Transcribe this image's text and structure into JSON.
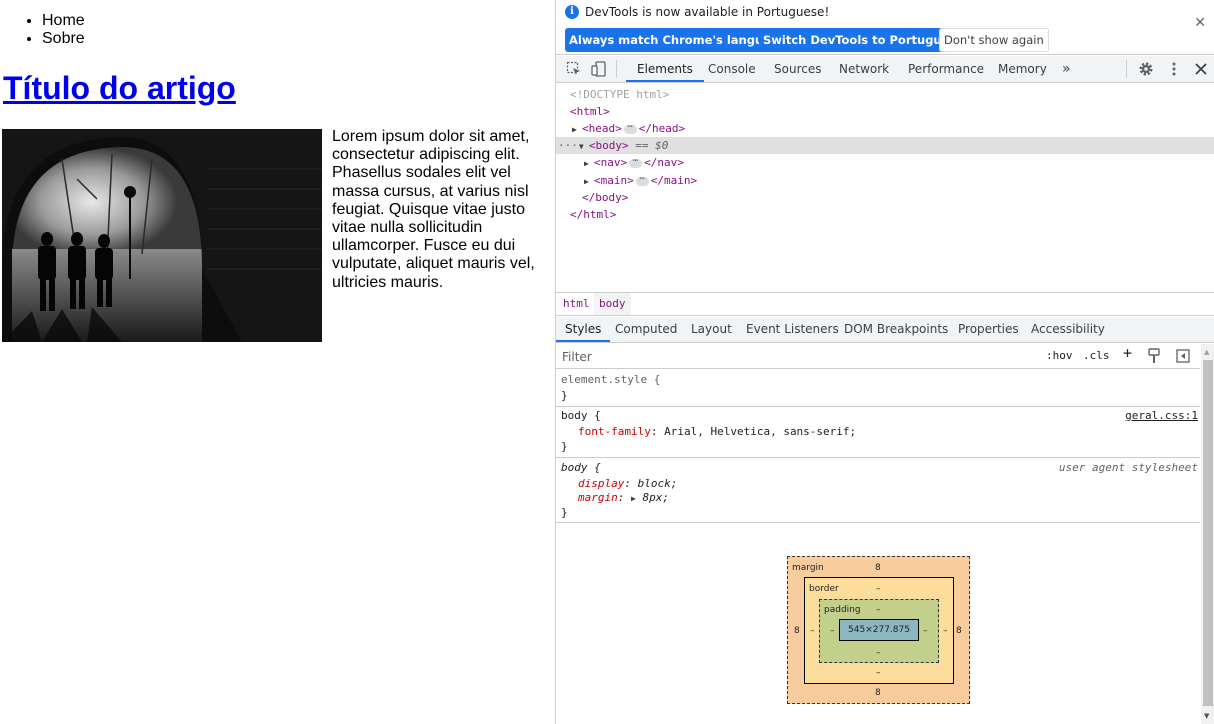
{
  "page": {
    "nav": [
      "Home",
      "Sobre"
    ],
    "article_title": "Título do artigo",
    "article_text": "Lorem ipsum dolor sit amet, consectetur adipiscing elit. Phasellus sodales elit vel massa cursus, at varius nisl feugiat. Quisque vitae justo vitae nulla sollicitudin ullamcorper. Fusce eu dui vulputate, aliquet mauris vel, ultricies mauris."
  },
  "infobar": {
    "message": "DevTools is now available in Portuguese!",
    "btn_match": "Always match Chrome's language",
    "btn_switch": "Switch DevTools to Portuguese",
    "btn_dismiss": "Don't show again"
  },
  "toolbar": {
    "tabs": [
      "Elements",
      "Console",
      "Sources",
      "Network",
      "Performance",
      "Memory"
    ],
    "more": "»"
  },
  "dom": {
    "doctype": "<!DOCTYPE html>",
    "html_open": "<html>",
    "head": "<head>",
    "head_close": "</head>",
    "body": "<body>",
    "body_marker": "== $0",
    "nav": "<nav>",
    "nav_close": "</nav>",
    "main": "<main>",
    "main_close": "</main>",
    "body_close": "</body>",
    "html_close": "</html>",
    "dots": "···"
  },
  "breadcrumbs": [
    "html",
    "body"
  ],
  "subtabs": [
    "Styles",
    "Computed",
    "Layout",
    "Event Listeners",
    "DOM Breakpoints",
    "Properties",
    "Accessibility"
  ],
  "filter": {
    "placeholder": "Filter",
    "hov": ":hov",
    "cls": ".cls",
    "plus": "+"
  },
  "rules": {
    "element_style": "element.style {",
    "close": "}",
    "body_selector": "body {",
    "body_source": "geral.css:1",
    "font_family_prop": "font-family",
    "font_family_val": "Arial, Helvetica, sans-serif;",
    "ua_selector": "body {",
    "ua_source": "user agent stylesheet",
    "display_prop": "display",
    "display_val": "block;",
    "margin_prop": "margin",
    "margin_val": "8px;"
  },
  "boxmodel": {
    "margin_label": "margin",
    "margin_top": "8",
    "margin_bottom": "8",
    "margin_left": "8",
    "margin_right": "8",
    "border_label": "border",
    "border_top": "–",
    "border_bottom": "–",
    "border_left": "–",
    "border_right": "–",
    "padding_label": "padding",
    "padding_top": "–",
    "padding_bottom": "–",
    "padding_left": "–",
    "padding_right": "–",
    "content": "545×277.875"
  },
  "colors": {
    "accent": "#1a73e8",
    "tag": "#881280",
    "prop": "#c80000"
  }
}
